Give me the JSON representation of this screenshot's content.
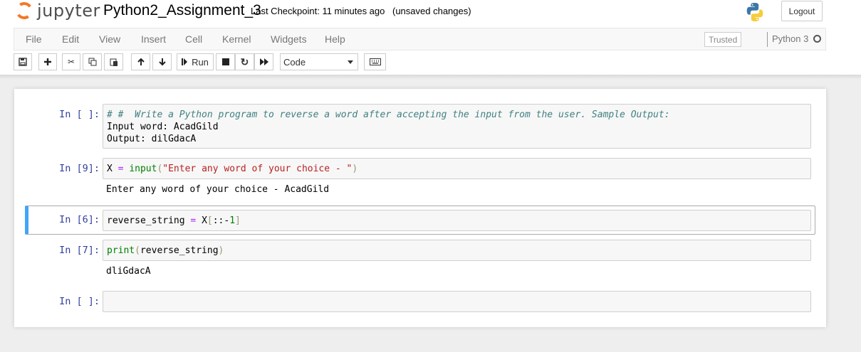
{
  "app": {
    "logo_text": "jupyter",
    "brand_color": "#f37726"
  },
  "header": {
    "notebook_title": "Python2_Assignment_3",
    "checkpoint": "Last Checkpoint: 11 minutes ago",
    "save_status": "(unsaved changes)",
    "logout_label": "Logout"
  },
  "menubar": {
    "items": [
      "File",
      "Edit",
      "View",
      "Insert",
      "Cell",
      "Kernel",
      "Widgets",
      "Help"
    ],
    "trusted_label": "Trusted",
    "kernel_name": "Python 3"
  },
  "toolbar": {
    "run_label": "Run",
    "cell_type": "Code",
    "icons": [
      "save-icon",
      "plus-icon",
      "cut-icon",
      "copy-icon",
      "paste-icon",
      "arrow-up-icon",
      "arrow-down-icon",
      "step-forward-icon",
      "stop-icon",
      "restart-icon",
      "fast-forward-icon",
      "keyboard-icon"
    ]
  },
  "cells": [
    {
      "prompt": "In [ ]:",
      "code_lines": [
        "# #  Write a Python program to reverse a word after accepting the input from the user. Sample Output:",
        "Input word: AcadGild",
        "Output: dilGdacA"
      ]
    },
    {
      "prompt": "In [9]:",
      "code": {
        "var": "X",
        "op": "=",
        "func": "input",
        "str": "\"Enter any word of your choice - \""
      },
      "output": "Enter any word of your choice - AcadGild"
    },
    {
      "prompt": "In [6]:",
      "code": {
        "var": "reverse_string",
        "op": "=",
        "obj": "X",
        "slice_open": "[",
        "slice_body": "::-",
        "num": "1",
        "slice_close": "]"
      },
      "selected": true
    },
    {
      "prompt": "In [7]:",
      "code": {
        "func": "print",
        "open": "(",
        "arg": "reverse_string",
        "close": ")"
      },
      "output": "dliGdacA"
    },
    {
      "prompt": "In [ ]:",
      "code_lines": [
        ""
      ]
    }
  ]
}
